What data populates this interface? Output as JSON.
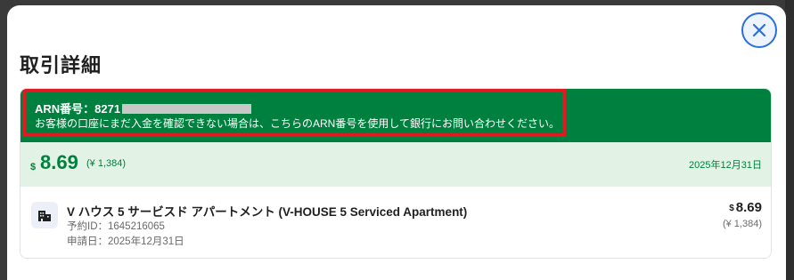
{
  "modal": {
    "title": "取引詳細",
    "close_icon": "close-icon"
  },
  "arn": {
    "label": "ARN番号：8271",
    "message": "お客様の口座にまだ入金を確認できない場合は、こちらのARN番号を使用して銀行にお問い合わせください。"
  },
  "summary": {
    "currency_symbol": "$",
    "amount": "8.69",
    "yen": "(¥ 1,384)",
    "date": "2025年12月31日"
  },
  "item": {
    "icon": "building-icon",
    "name": "V ハウス 5 サービスド アパートメント (V-HOUSE 5 Serviced Apartment)",
    "reservation_id": "予約ID：1645216065",
    "request_date": "申請日：2025年12月31日",
    "currency_symbol": "$",
    "amount": "8.69",
    "yen": "(¥ 1,384)"
  },
  "colors": {
    "banner_green": "#00803e",
    "summary_bg": "#e2f3e6",
    "highlight_red": "#e01a22",
    "close_blue": "#2a6fdb"
  }
}
